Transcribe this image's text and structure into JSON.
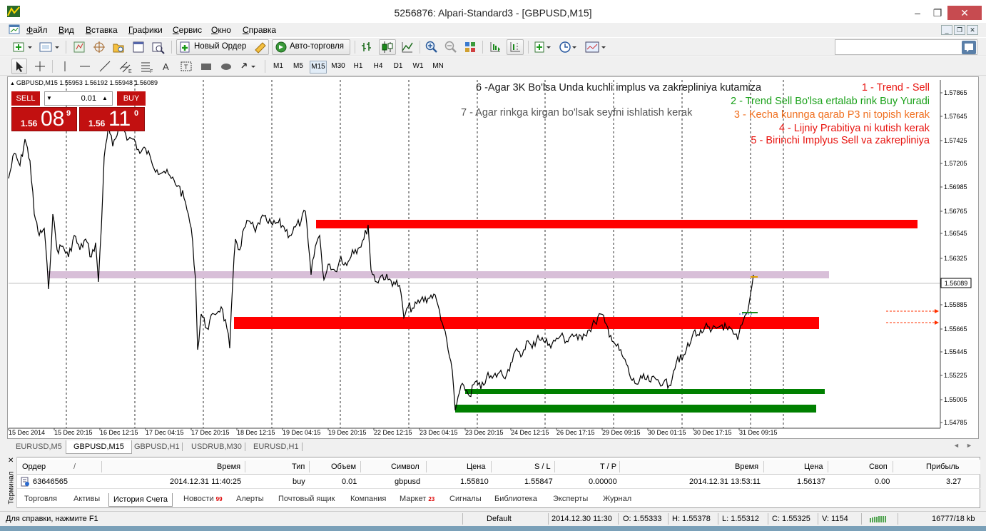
{
  "window": {
    "title": "5256876: Alpari-Standard3 - [GBPUSD,M15]",
    "minimize": "–",
    "restore": "❐",
    "close": "✕"
  },
  "menu": [
    "Файл",
    "Вид",
    "Вставка",
    "Графики",
    "Сервис",
    "Окно",
    "Справка"
  ],
  "toolbar": {
    "new_order": "Новый Ордер",
    "auto_trading": "Авто-торговля",
    "timeframes": [
      "M1",
      "M5",
      "M15",
      "M30",
      "H1",
      "H4",
      "D1",
      "W1",
      "MN"
    ],
    "active_timeframe": "M15"
  },
  "chart": {
    "header": "GBPUSD,M15  1.55953 1.56192 1.55948 1.56089",
    "trade_panel": {
      "sell_label": "SELL",
      "buy_label": "BUY",
      "lot": "0.01",
      "sell_prefix": "1.56",
      "sell_big": "08",
      "sell_sup": "9",
      "buy_prefix": "1.56",
      "buy_big": "11",
      "buy_sup": "0"
    },
    "notes": [
      {
        "text": "6 -Agar 3K Bo'lsa Unda kuchli implus va zakrepliniya kutamiza",
        "color": "#1a1a1a"
      },
      {
        "text": "7 - Agar rinkga kirgan bo'lsak seyfni ishlatish kerak",
        "color": "#555555"
      },
      {
        "text": "1 - Trend - Sell",
        "color": "#e8140f"
      },
      {
        "text": "2 - Trend Sell Bo'lsa ertalab rink Buy Yuradi",
        "color": "#1aa11a"
      },
      {
        "text": "3 - Kecha kunnga qarab P3 ni topish kerak",
        "color": "#f07020"
      },
      {
        "text": "4 - Lijniy Prabitiya ni kutish kerak",
        "color": "#e8140f"
      },
      {
        "text": "5 - Birinchi Implyus Sell va zakrepliniya",
        "color": "#e8140f"
      }
    ],
    "price_labels": [
      "1.57865",
      "1.57645",
      "1.57425",
      "1.57205",
      "1.56985",
      "1.56765",
      "1.56545",
      "1.56325",
      "1.55885",
      "1.55665",
      "1.55445",
      "1.55225",
      "1.55005",
      "1.54785"
    ],
    "current_price": "1.56089",
    "time_labels": [
      "15 Dec 2014",
      "15 Dec 20:15",
      "16 Dec 12:15",
      "17 Dec 04:15",
      "17 Dec 20:15",
      "18 Dec 12:15",
      "19 Dec 04:15",
      "19 Dec 20:15",
      "22 Dec 12:15",
      "23 Dec 04:15",
      "23 Dec 20:15",
      "24 Dec 12:15",
      "26 Dec 17:15",
      "29 Dec 09:15",
      "30 Dec 01:15",
      "30 Dec 17:15",
      "31 Dec 09:15"
    ],
    "colors": {
      "red_zone": "#ff0000",
      "green_zone": "#008000",
      "lilac_zone": "#d8bfd8",
      "candles": "#000000"
    }
  },
  "chart_tabs": [
    "EURUSD,M5",
    "GBPUSD,M15",
    "GBPUSD,H1",
    "USDRUB,M30",
    "EURUSD,H1"
  ],
  "active_chart_tab": "GBPUSD,M15",
  "terminal": {
    "side_label": "Терминал",
    "columns": [
      "Ордер",
      "/",
      "Время",
      "Тип",
      "Объем",
      "Символ",
      "Цена",
      "S / L",
      "T / P",
      "Время",
      "Цена",
      "Своп",
      "Прибыль"
    ],
    "rows": [
      [
        "63646565",
        "2014.12.31 11:40:25",
        "buy",
        "0.01",
        "gbpusd",
        "1.55810",
        "1.55847",
        "0.00000",
        "2014.12.31 13:53:11",
        "1.56137",
        "0.00",
        "3.27"
      ]
    ],
    "tabs": [
      {
        "label": "Торговля",
        "badge": ""
      },
      {
        "label": "Активы",
        "badge": ""
      },
      {
        "label": "История Счета",
        "badge": ""
      },
      {
        "label": "Новости",
        "badge": "99"
      },
      {
        "label": "Алерты",
        "badge": ""
      },
      {
        "label": "Почтовый ящик",
        "badge": ""
      },
      {
        "label": "Компания",
        "badge": ""
      },
      {
        "label": "Маркет",
        "badge": "23"
      },
      {
        "label": "Сигналы",
        "badge": ""
      },
      {
        "label": "Библиотека",
        "badge": ""
      },
      {
        "label": "Эксперты",
        "badge": ""
      },
      {
        "label": "Журнал",
        "badge": ""
      }
    ],
    "active_tab": "История Счета"
  },
  "status": {
    "help": "Для справки, нажмите F1",
    "profile": "Default",
    "time": "2014.12.30 11:30",
    "open": "O: 1.55333",
    "high": "H: 1.55378",
    "low": "L: 1.55312",
    "close": "C: 1.55325",
    "volume": "V: 1154",
    "traffic": "16777/18 kb"
  }
}
